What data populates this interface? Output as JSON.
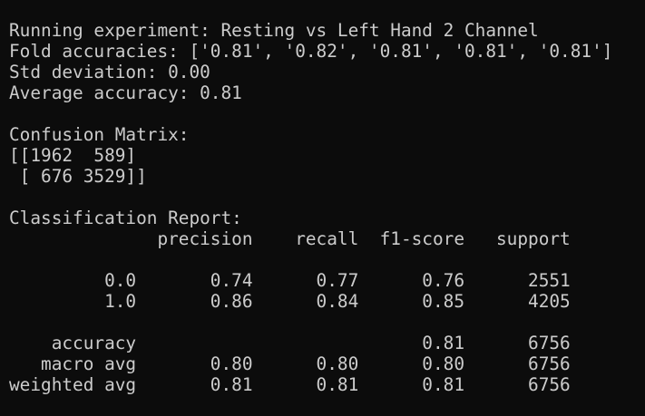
{
  "terminal": {
    "bg_color": "#0c0c0c",
    "text_color": "#cccccc",
    "lines": [
      "Running experiment: Resting vs Left Hand 2 Channel",
      "Fold accuracies: ['0.81', '0.82', '0.81', '0.81', '0.81']",
      "Std deviation: 0.00",
      "Average accuracy: 0.81",
      "",
      "Confusion Matrix:",
      "[[1962  589]",
      " [ 676 3529]]",
      "",
      "Classification Report:",
      "              precision    recall  f1-score   support",
      "",
      "         0.0       0.74      0.77      0.76      2551",
      "         1.0       0.86      0.84      0.85      4205",
      "",
      "    accuracy                           0.81      6756",
      "   macro avg       0.80      0.80      0.80      6756",
      "weighted avg       0.81      0.81      0.81      6756"
    ]
  }
}
